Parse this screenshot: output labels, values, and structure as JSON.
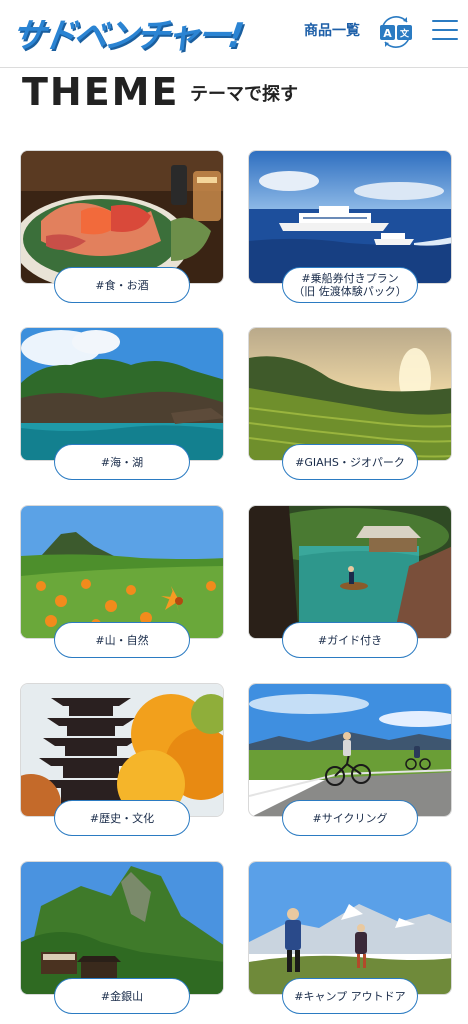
{
  "header": {
    "logo_text": "サドベンチャー!",
    "nav_products": "商品一覧",
    "lang_icon": "translate-icon",
    "menu_icon": "hamburger-menu-icon"
  },
  "section": {
    "title": "THEME",
    "subtitle": "テーマで探す"
  },
  "themes": [
    {
      "label": "#食・お酒",
      "image": "sashimi-and-sake"
    },
    {
      "label": "#乗船券付きプラン（旧 佐渡体験パック）",
      "image": "ferry-on-sea"
    },
    {
      "label": "#海・湖",
      "image": "coastal-rocks"
    },
    {
      "label": "#GIAHS・ジオパーク",
      "image": "terraced-rice-fields"
    },
    {
      "label": "#山・自然",
      "image": "lily-flower-field"
    },
    {
      "label": "#ガイド付き",
      "image": "tub-boat"
    },
    {
      "label": "#歴史・文化",
      "image": "five-story-pagoda"
    },
    {
      "label": "#サイクリング",
      "image": "cyclists-on-road"
    },
    {
      "label": "#金銀山",
      "image": "split-mountain"
    },
    {
      "label": "#キャンプ アウトドア",
      "image": "hikers-snowy-mountains"
    }
  ],
  "colors": {
    "accent": "#2b7bc2",
    "logo": "#2b84d3",
    "text": "#222222"
  }
}
